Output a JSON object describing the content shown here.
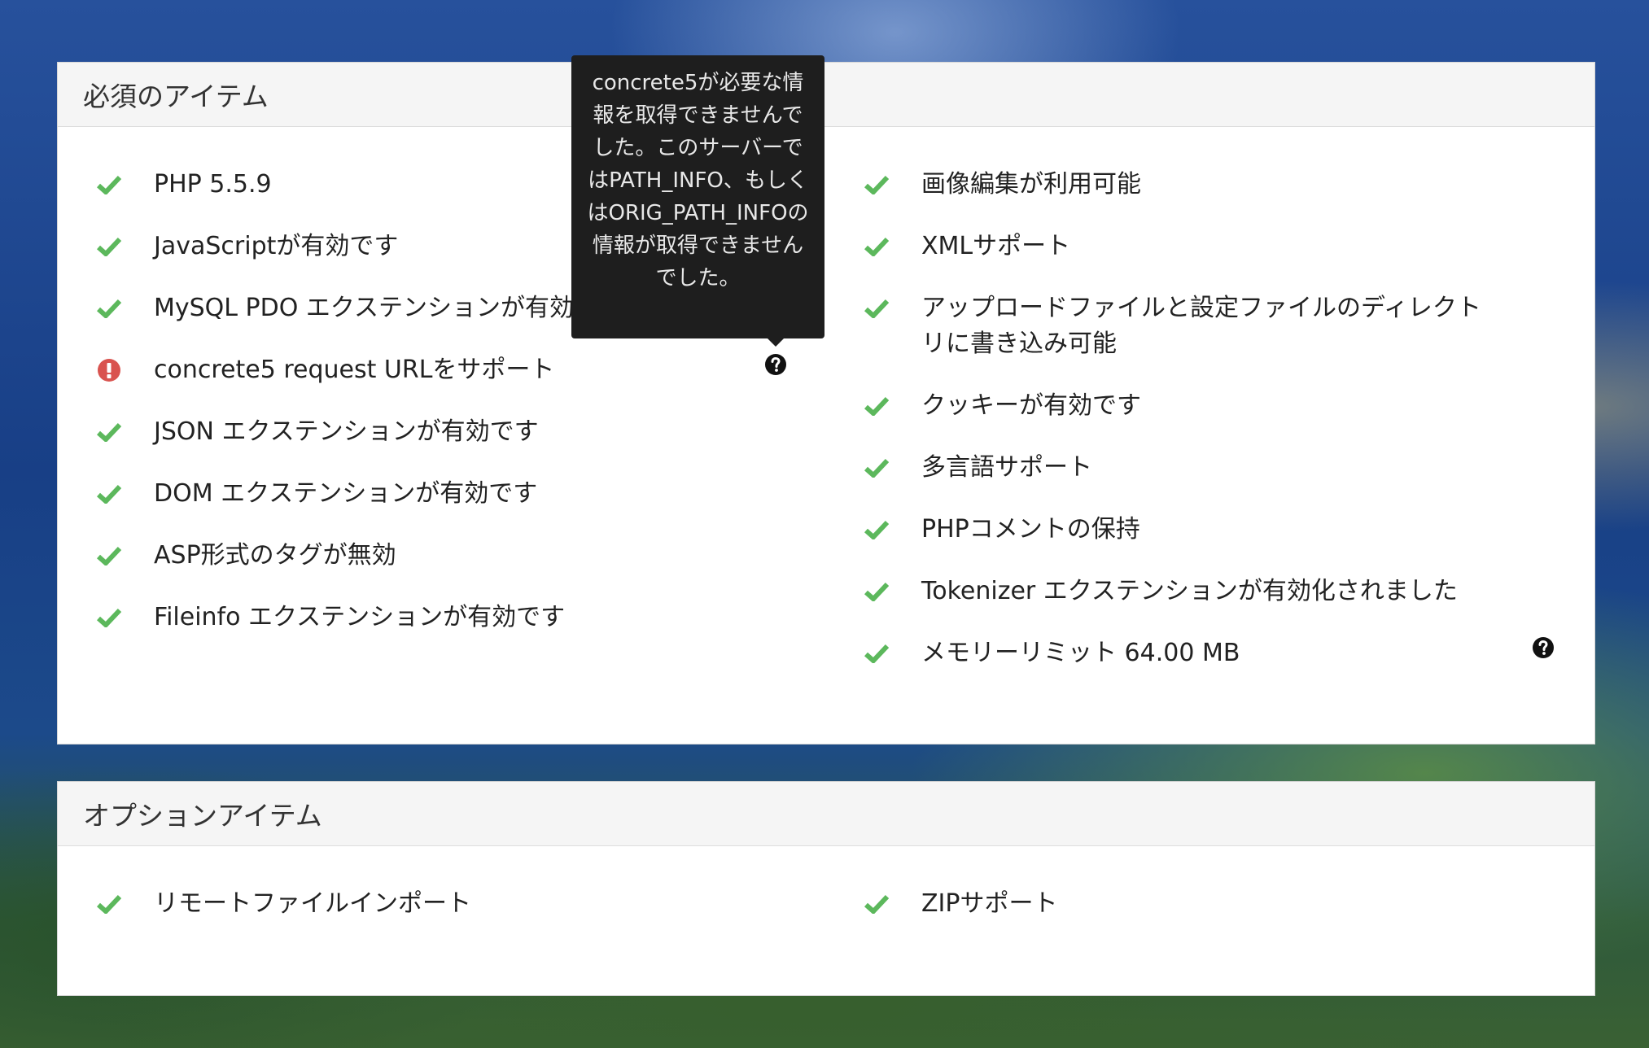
{
  "colors": {
    "check": "#5cb85c",
    "error": "#d9534f",
    "tooltip_bg": "#1e1e1e"
  },
  "required": {
    "title": "必須のアイテム",
    "left_items": [
      {
        "label": "PHP 5.5.9",
        "status": "check-icon"
      },
      {
        "label": "JavaScriptが有効です",
        "status": "check-icon"
      },
      {
        "label": "MySQL PDO エクステンションが有効です",
        "status": "check-icon"
      },
      {
        "label": "concrete5 request URLをサポート",
        "status": "error-icon"
      },
      {
        "label": "JSON エクステンションが有効です",
        "status": "check-icon"
      },
      {
        "label": "DOM エクステンションが有効です",
        "status": "check-icon"
      },
      {
        "label": "ASP形式のタグが無効",
        "status": "check-icon"
      },
      {
        "label": "Fileinfo エクステンションが有効です",
        "status": "check-icon"
      }
    ],
    "right_items": [
      {
        "label": "画像編集が利用可能",
        "status": "check-icon"
      },
      {
        "label": "XMLサポート",
        "status": "check-icon"
      },
      {
        "label": "アップロードファイルと設定ファイルのディレクトリに書き込み可能",
        "status": "check-icon"
      },
      {
        "label": "クッキーが有効です",
        "status": "check-icon"
      },
      {
        "label": "多言語サポート",
        "status": "check-icon"
      },
      {
        "label": "PHPコメントの保持",
        "status": "check-icon"
      },
      {
        "label": "Tokenizer エクステンションが有効化されました",
        "status": "check-icon"
      },
      {
        "label": "メモリーリミット 64.00 MB",
        "status": "check-icon"
      }
    ]
  },
  "tooltip": {
    "text": "concrete5が必要な情報を取得できませんでした。このサーバーではPATH_INFO、もしくはORIG_PATH_INFOの情報が取得できませんでした。"
  },
  "optional": {
    "title": "オプションアイテム",
    "left_items": [
      {
        "label": "リモートファイルインポート",
        "status": "check-icon"
      }
    ],
    "right_items": [
      {
        "label": "ZIPサポート",
        "status": "check-icon"
      }
    ]
  }
}
